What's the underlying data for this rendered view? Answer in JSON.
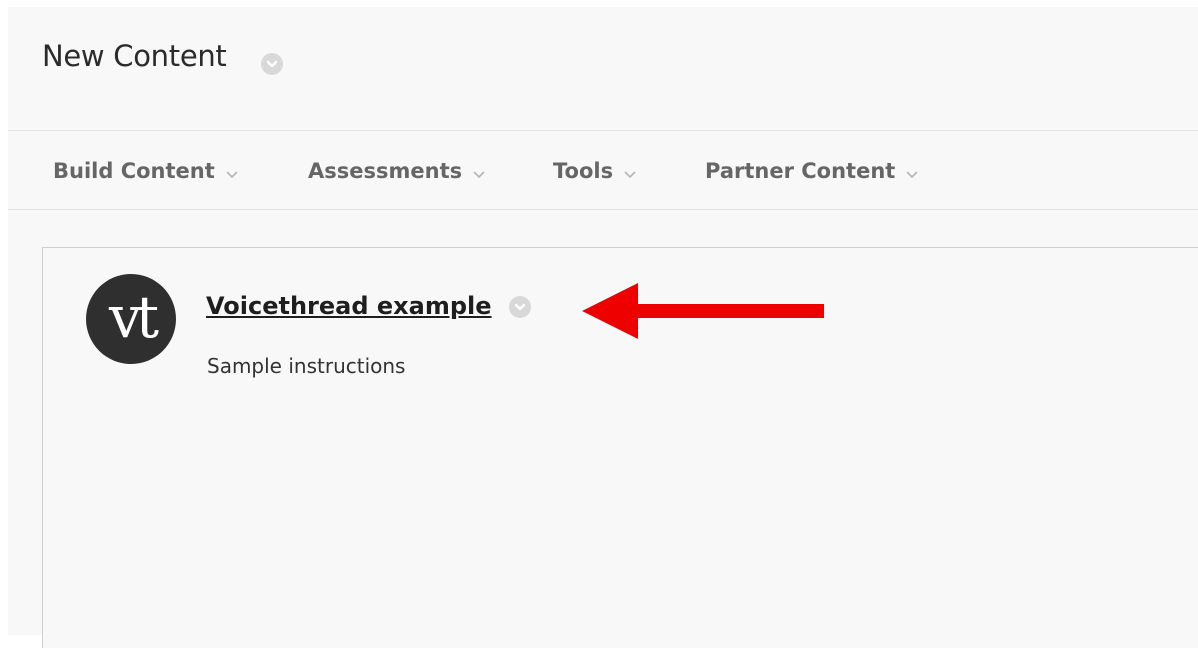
{
  "page": {
    "title": "New Content"
  },
  "toolbar": {
    "items": [
      {
        "label": "Build Content"
      },
      {
        "label": "Assessments"
      },
      {
        "label": "Tools"
      },
      {
        "label": "Partner Content"
      }
    ]
  },
  "content_item": {
    "logo_text": "vt",
    "title": "Voicethread example",
    "description": "Sample instructions"
  },
  "colors": {
    "background": "#f8f8f8",
    "annotation_arrow": "#ee0000",
    "logo_background": "#2f2f2f",
    "menu_text": "#666666"
  },
  "icons": {
    "title_menu": "chevron-down-circle-icon",
    "toolbar_caret": "chevron-down-icon",
    "logo": "voicethread-logo",
    "annotation": "left-arrow-annotation"
  }
}
